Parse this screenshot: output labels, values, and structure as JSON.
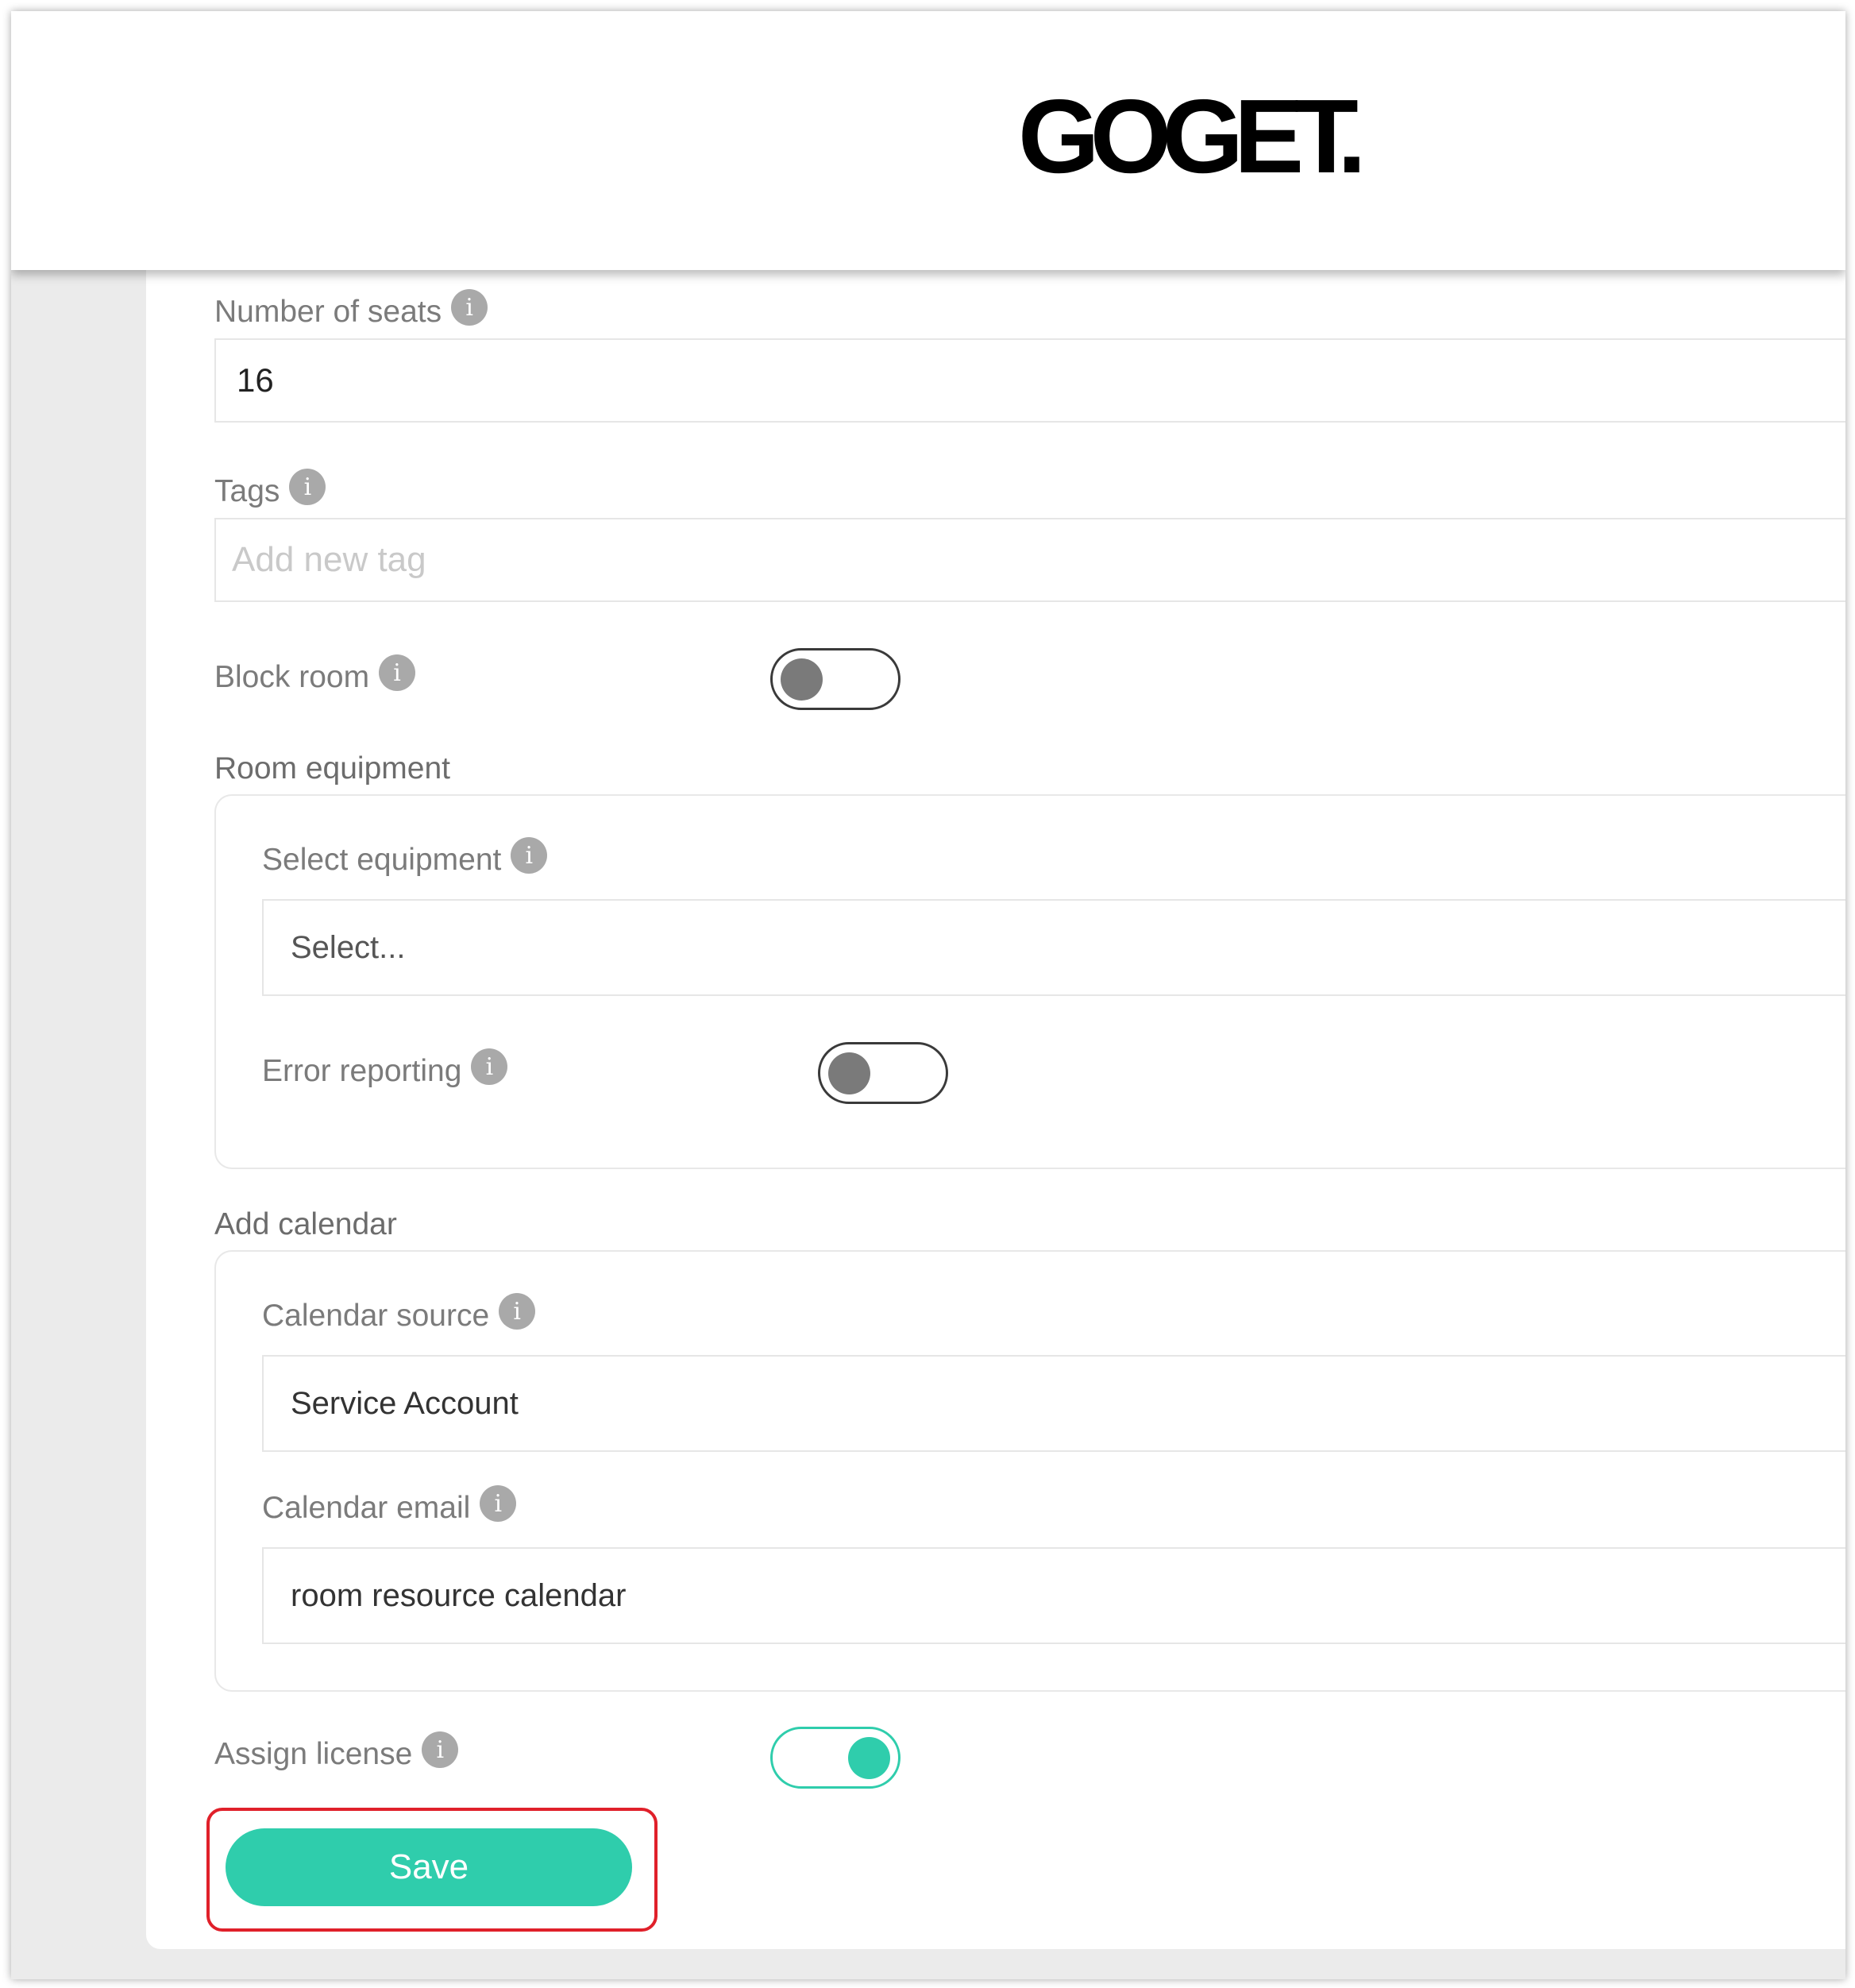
{
  "header": {
    "logo_text": "GOGET."
  },
  "form": {
    "seats": {
      "label": "Number of seats",
      "value": "16"
    },
    "tags": {
      "label": "Tags",
      "placeholder": "Add new tag"
    },
    "block_room": {
      "label": "Block room",
      "state": "off"
    },
    "room_equipment": {
      "title": "Room equipment",
      "select_label": "Select equipment",
      "select_value": "Select...",
      "error_reporting_label": "Error reporting",
      "error_reporting_state": "off"
    },
    "add_calendar": {
      "title": "Add calendar",
      "source_label": "Calendar source",
      "source_value": "Service Account",
      "email_label": "Calendar email",
      "email_value": "room resource calendar"
    },
    "assign_license": {
      "label": "Assign license",
      "state": "on"
    },
    "save_label": "Save"
  },
  "info_glyph": "i",
  "colors": {
    "accent": "#2fcdac",
    "toggle_off_knob": "#7a7a7a",
    "info_icon": "#a9a9a9",
    "highlight": "#e0202a"
  }
}
